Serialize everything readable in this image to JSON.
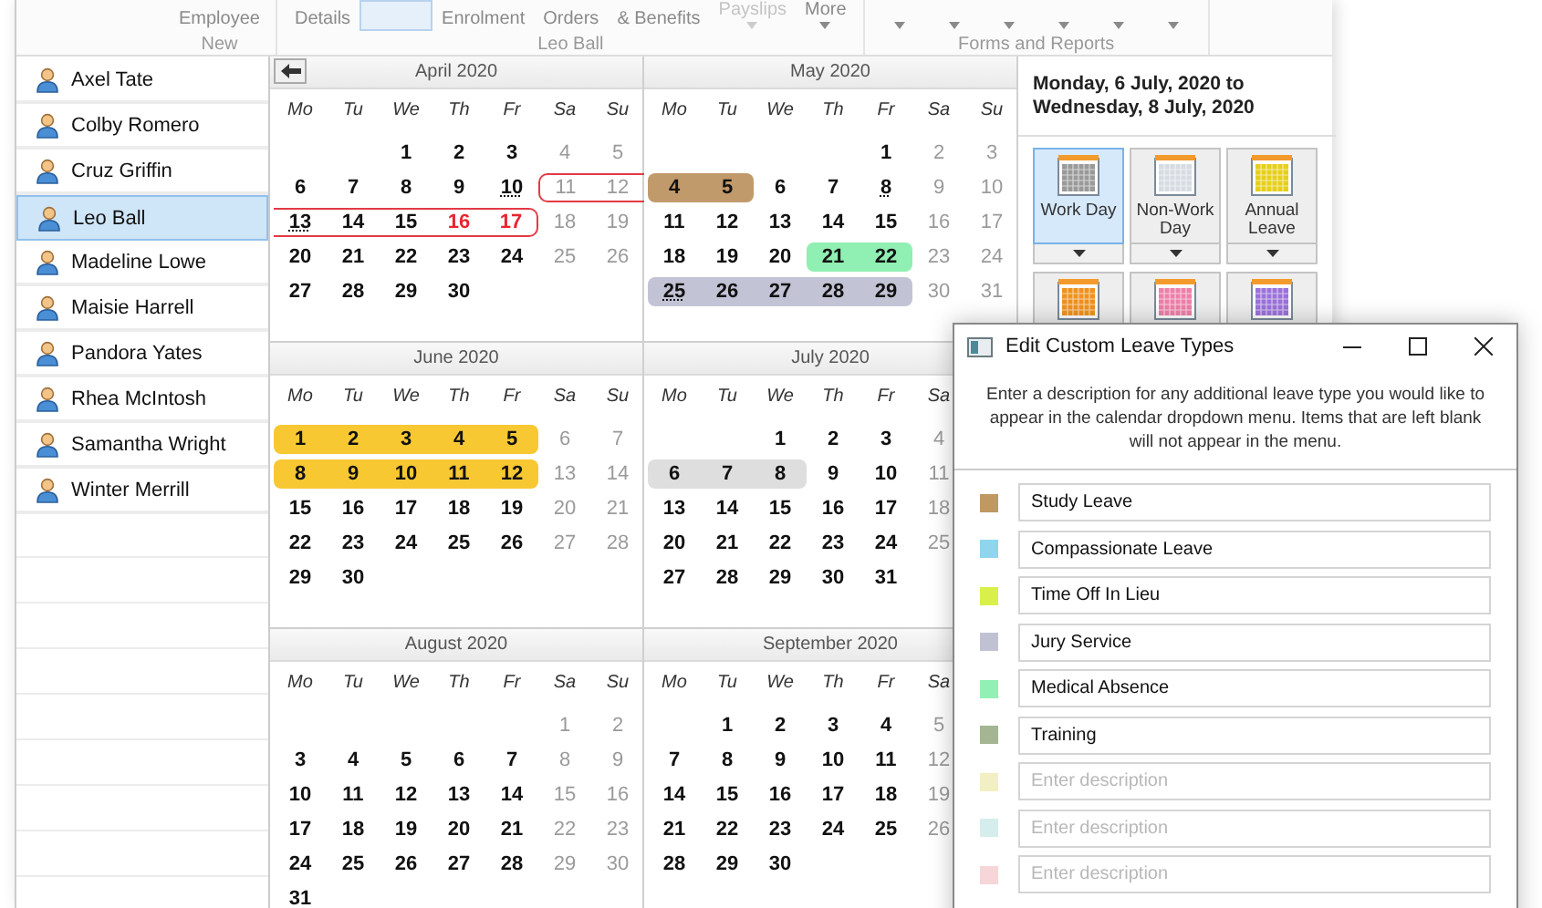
{
  "ribbon": {
    "groups": [
      {
        "label": "New",
        "items": [
          {
            "label": "Employee",
            "selected": false,
            "disabled": false
          }
        ]
      },
      {
        "label": "Leo Ball",
        "items": [
          {
            "label": "Details",
            "selected": false,
            "disabled": false
          },
          {
            "selected": true,
            "disabled": false
          },
          {
            "label": "Enrolment",
            "selected": false,
            "disabled": false
          },
          {
            "label": "Orders",
            "selected": false,
            "disabled": false
          },
          {
            "label": "& Benefits",
            "selected": false,
            "disabled": false
          },
          {
            "label": "Payslips",
            "arrow": true,
            "selected": false,
            "disabled": true
          },
          {
            "label": "More",
            "arrow": true,
            "selected": false,
            "disabled": false
          }
        ]
      },
      {
        "label": "Forms and Reports",
        "items": [
          {
            "arrow": true,
            "selected": false
          },
          {
            "arrow": true,
            "selected": false
          },
          {
            "arrow": true,
            "selected": false
          },
          {
            "arrow": true,
            "selected": false
          },
          {
            "arrow": true,
            "selected": false
          },
          {
            "arrow": true,
            "selected": false
          }
        ]
      }
    ]
  },
  "employees": [
    {
      "name": "Axel Tate",
      "selected": false
    },
    {
      "name": "Colby Romero",
      "selected": false
    },
    {
      "name": "Cruz Griffin",
      "selected": false
    },
    {
      "name": "Leo Ball",
      "selected": true
    },
    {
      "name": "Madeline Lowe",
      "selected": false
    },
    {
      "name": "Maisie Harrell",
      "selected": false
    },
    {
      "name": "Pandora Yates",
      "selected": false
    },
    {
      "name": "Rhea McIntosh",
      "selected": false
    },
    {
      "name": "Samantha Wright",
      "selected": false
    },
    {
      "name": "Winter Merrill",
      "selected": false
    }
  ],
  "months": [
    {
      "title": "April 2020",
      "back_button": true,
      "weekdays": [
        "Mo",
        "Tu",
        "We",
        "Th",
        "Fr",
        "Sa",
        "Su"
      ],
      "weeks": [
        [
          "1",
          "2",
          "3",
          "4",
          "5"
        ],
        [
          "6",
          "7",
          "8",
          "9",
          {
            "d": "10",
            "dotted": true
          },
          {
            "d": "11",
            "outline": true
          },
          {
            "d": "12",
            "outline": true
          }
        ],
        [
          {
            "d": "13",
            "dotted": true,
            "outline": true
          },
          {
            "d": "14",
            "outline": true
          },
          {
            "d": "15",
            "outline": true
          },
          {
            "d": "16",
            "outline": true,
            "red": true
          },
          {
            "d": "17",
            "outline": true,
            "red": true
          },
          "18",
          "19"
        ],
        [
          "20",
          "21",
          "22",
          "23",
          "24",
          "25",
          "26"
        ],
        [
          "27",
          "28",
          "29",
          "30"
        ]
      ]
    },
    {
      "title": "May 2020",
      "weekdays": [
        "Mo",
        "Tu",
        "We",
        "Th",
        "Fr",
        "Sa",
        "Su"
      ],
      "weeks": [
        [
          "1",
          "2",
          "3"
        ],
        [
          {
            "d": "4",
            "color": "#c19a6b"
          },
          {
            "d": "5",
            "color": "#c19a6b"
          },
          "6",
          "7",
          {
            "d": "8",
            "dotted": true
          },
          "9",
          "10"
        ],
        [
          "11",
          "12",
          "13",
          "14",
          "15",
          "16",
          "17"
        ],
        [
          "18",
          "19",
          "20",
          {
            "d": "21",
            "color": "#90efb2"
          },
          {
            "d": "22",
            "color": "#90efb2"
          },
          "23",
          "24"
        ],
        [
          {
            "d": "25",
            "dotted": true,
            "color": "#c2c4d6"
          },
          {
            "d": "26",
            "color": "#c2c4d6"
          },
          {
            "d": "27",
            "color": "#c2c4d6"
          },
          {
            "d": "28",
            "color": "#c2c4d6"
          },
          {
            "d": "29",
            "color": "#c2c4d6"
          },
          "30",
          "31"
        ]
      ]
    },
    {
      "title": "June 2020",
      "weekdays": [
        "Mo",
        "Tu",
        "We",
        "Th",
        "Fr",
        "Sa",
        "Su"
      ],
      "weeks": [
        [
          {
            "d": "1",
            "color": "#f8c832"
          },
          {
            "d": "2",
            "color": "#f8c832"
          },
          {
            "d": "3",
            "color": "#f8c832"
          },
          {
            "d": "4",
            "color": "#f8c832"
          },
          {
            "d": "5",
            "color": "#f8c832"
          },
          "6",
          "7"
        ],
        [
          {
            "d": "8",
            "color": "#f8c832"
          },
          {
            "d": "9",
            "color": "#f8c832"
          },
          {
            "d": "10",
            "color": "#f8c832"
          },
          {
            "d": "11",
            "color": "#f8c832"
          },
          {
            "d": "12",
            "color": "#f8c832"
          },
          "13",
          "14"
        ],
        [
          "15",
          "16",
          "17",
          "18",
          "19",
          "20",
          "21"
        ],
        [
          "22",
          "23",
          "24",
          "25",
          "26",
          "27",
          "28"
        ],
        [
          "29",
          "30"
        ]
      ]
    },
    {
      "title": "July 2020",
      "weekdays": [
        "Mo",
        "Tu",
        "We",
        "Th",
        "Fr",
        "Sa"
      ],
      "weeks": [
        [
          "1",
          "2",
          "3",
          "4"
        ],
        [
          {
            "d": "6",
            "color": "#dedede"
          },
          {
            "d": "7",
            "color": "#dedede"
          },
          {
            "d": "8",
            "color": "#dedede"
          },
          "9",
          "10",
          "11"
        ],
        [
          "13",
          "14",
          "15",
          "16",
          "17",
          "18"
        ],
        [
          "20",
          "21",
          "22",
          "23",
          "24",
          "25"
        ],
        [
          "27",
          "28",
          "29",
          "30",
          "31"
        ]
      ]
    },
    {
      "title": "August 2020",
      "weekdays": [
        "Mo",
        "Tu",
        "We",
        "Th",
        "Fr",
        "Sa",
        "Su"
      ],
      "weeks": [
        [
          "1",
          "2"
        ],
        [
          "3",
          "4",
          "5",
          "6",
          "7",
          "8",
          "9"
        ],
        [
          "10",
          "11",
          "12",
          "13",
          "14",
          "15",
          "16"
        ],
        [
          "17",
          "18",
          "19",
          "20",
          "21",
          "22",
          "23"
        ],
        [
          "24",
          "25",
          "26",
          "27",
          "28",
          "29",
          "30"
        ],
        [
          "31"
        ]
      ]
    },
    {
      "title": "September 2020",
      "weekdays": [
        "Mo",
        "Tu",
        "We",
        "Th",
        "Fr",
        "Sa"
      ],
      "weeks": [
        [
          "1",
          "2",
          "3",
          "4",
          "5"
        ],
        [
          "7",
          "8",
          "9",
          "10",
          "11",
          "12"
        ],
        [
          "14",
          "15",
          "16",
          "17",
          "18",
          "19"
        ],
        [
          "21",
          "22",
          "23",
          "24",
          "25",
          "26"
        ],
        [
          "28",
          "29",
          "30"
        ]
      ]
    }
  ],
  "selection": {
    "range": "Monday, 6 July, 2020 to Wednesday, 8 July, 2020"
  },
  "day_types": [
    {
      "label": "Work Day",
      "color": "#9a9a9a",
      "selected": true
    },
    {
      "label": "Non-Work Day",
      "color": "#d6dce2",
      "selected": false
    },
    {
      "label": "Annual Leave",
      "color": "#e6cf1c",
      "selected": false
    },
    {
      "color": "#f0921e",
      "selected": false
    },
    {
      "color": "#ec80a8",
      "selected": false
    },
    {
      "color": "#9b72d9",
      "selected": false
    }
  ],
  "dialog": {
    "title": "Edit Custom Leave Types",
    "description": "Enter a description for any additional leave type you would like to appear in the calendar dropdown menu. Items that are left blank will not appear in the menu.",
    "leave_types": [
      {
        "color": "#bf9862",
        "value": "Study Leave"
      },
      {
        "color": "#8fd5ee",
        "value": "Compassionate Leave"
      },
      {
        "color": "#d9ef4a",
        "value": "Time Off In Lieu"
      },
      {
        "color": "#c0c2d4",
        "value": "Jury Service"
      },
      {
        "color": "#92f0b4",
        "value": "Medical Absence"
      },
      {
        "color": "#a3b592",
        "value": "Training"
      },
      {
        "color": "#f3efc4",
        "placeholder": "Enter description"
      },
      {
        "color": "#d6eded",
        "placeholder": "Enter description"
      },
      {
        "color": "#f6d6d8",
        "placeholder": "Enter description"
      }
    ]
  }
}
